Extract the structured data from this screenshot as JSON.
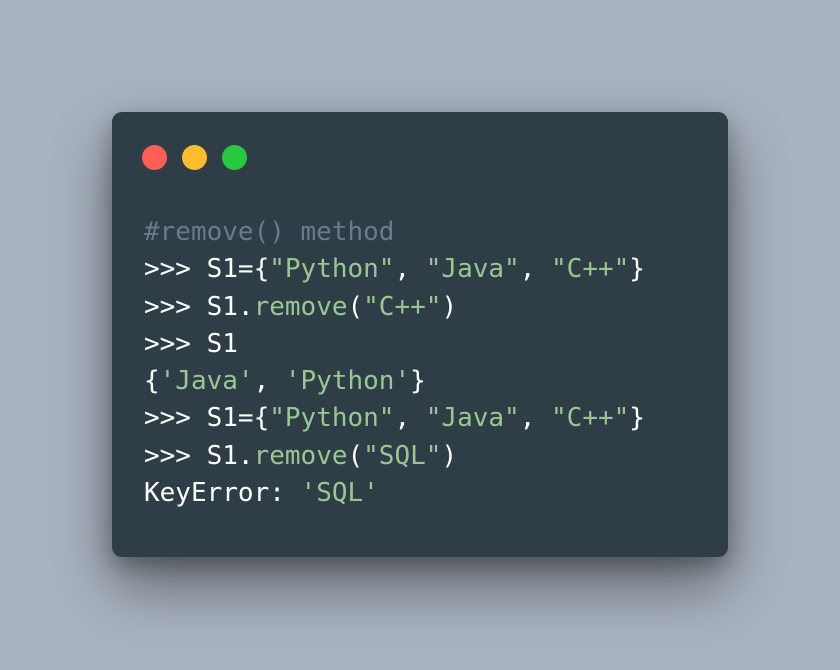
{
  "colors": {
    "background": "#a9b3bf",
    "window": "#2f3e46",
    "default": "#ffffff",
    "comment": "#6b7b85",
    "string": "#99c794",
    "method": "#99c794"
  },
  "window_controls": [
    {
      "name": "close-dot-icon",
      "color": "#ff5f56"
    },
    {
      "name": "minimize-dot-icon",
      "color": "#ffbd2e"
    },
    {
      "name": "maximize-dot-icon",
      "color": "#27c93f"
    }
  ],
  "code_lines": [
    [
      {
        "t": "#remove() method",
        "c": "comment"
      }
    ],
    [
      {
        "t": ">>> S1={",
        "c": "default"
      },
      {
        "t": "\"Python\"",
        "c": "string"
      },
      {
        "t": ", ",
        "c": "default"
      },
      {
        "t": "\"Java\"",
        "c": "string"
      },
      {
        "t": ", ",
        "c": "default"
      },
      {
        "t": "\"C++\"",
        "c": "string"
      },
      {
        "t": "}",
        "c": "default"
      }
    ],
    [
      {
        "t": ">>> S1.",
        "c": "default"
      },
      {
        "t": "remove",
        "c": "method"
      },
      {
        "t": "(",
        "c": "default"
      },
      {
        "t": "\"C++\"",
        "c": "string"
      },
      {
        "t": ")",
        "c": "default"
      }
    ],
    [
      {
        "t": ">>> S1",
        "c": "default"
      }
    ],
    [
      {
        "t": "{",
        "c": "default"
      },
      {
        "t": "'Java'",
        "c": "string"
      },
      {
        "t": ", ",
        "c": "default"
      },
      {
        "t": "'Python'",
        "c": "string"
      },
      {
        "t": "}",
        "c": "default"
      }
    ],
    [
      {
        "t": ">>> S1={",
        "c": "default"
      },
      {
        "t": "\"Python\"",
        "c": "string"
      },
      {
        "t": ", ",
        "c": "default"
      },
      {
        "t": "\"Java\"",
        "c": "string"
      },
      {
        "t": ", ",
        "c": "default"
      },
      {
        "t": "\"C++\"",
        "c": "string"
      },
      {
        "t": "}",
        "c": "default"
      }
    ],
    [
      {
        "t": ">>> S1.",
        "c": "default"
      },
      {
        "t": "remove",
        "c": "method"
      },
      {
        "t": "(",
        "c": "default"
      },
      {
        "t": "\"SQL\"",
        "c": "string"
      },
      {
        "t": ")",
        "c": "default"
      }
    ],
    [
      {
        "t": "KeyError: ",
        "c": "default"
      },
      {
        "t": "'SQL'",
        "c": "string"
      }
    ]
  ]
}
